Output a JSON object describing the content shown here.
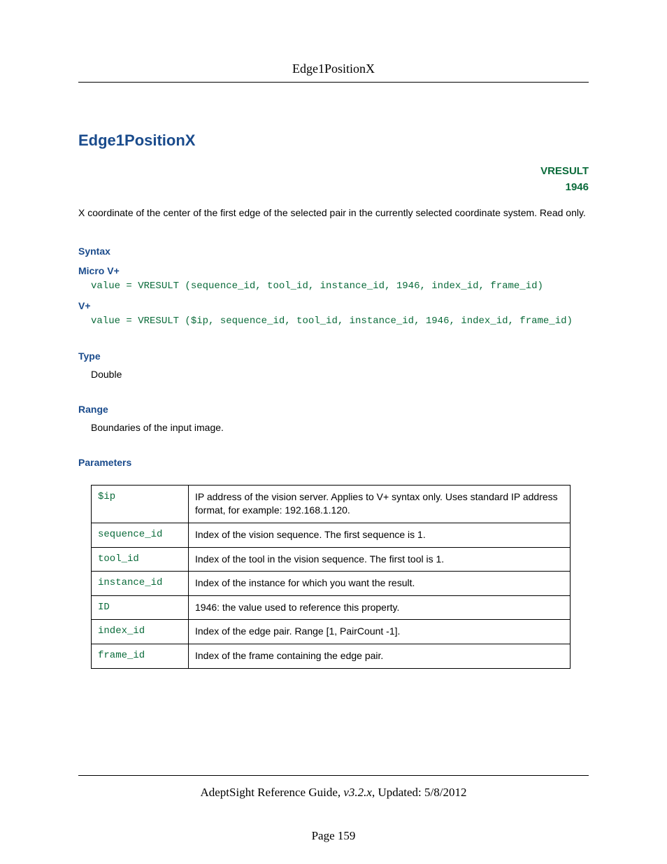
{
  "header": {
    "title": "Edge1PositionX"
  },
  "main": {
    "title": "Edge1PositionX",
    "badge": {
      "line1": "VRESULT",
      "line2": "1946"
    },
    "description": "X coordinate of the center of the first edge of the selected pair in the currently selected coordinate system. Read only."
  },
  "syntax": {
    "heading": "Syntax",
    "micro": {
      "label": "Micro V+",
      "code": "value = VRESULT (sequence_id, tool_id, instance_id, 1946, index_id, frame_id)"
    },
    "vplus": {
      "label": "V+",
      "code": "value = VRESULT ($ip, sequence_id, tool_id, instance_id, 1946, index_id, frame_id)"
    }
  },
  "type": {
    "heading": "Type",
    "value": "Double"
  },
  "range": {
    "heading": "Range",
    "value": "Boundaries of the input image."
  },
  "parameters": {
    "heading": "Parameters",
    "rows": [
      {
        "name": "$ip",
        "desc": "IP address of the vision server. Applies to V+ syntax only. Uses standard IP address format, for example: 192.168.1.120."
      },
      {
        "name": "sequence_id",
        "desc": "Index of the vision sequence. The first sequence is 1."
      },
      {
        "name": "tool_id",
        "desc": "Index of the tool in the vision sequence. The first tool is 1."
      },
      {
        "name": "instance_id",
        "desc": "Index of the instance for which you want the result."
      },
      {
        "name": "ID",
        "desc": "1946: the value used to reference this property."
      },
      {
        "name": "index_id",
        "desc": "Index of the edge pair. Range [1, PairCount -1]."
      },
      {
        "name": "frame_id",
        "desc": "Index of the frame containing the edge pair."
      }
    ]
  },
  "footer": {
    "doc_title": "AdeptSight Reference Guide",
    "version": ", v3.2.x",
    "updated_label": ", Updated: ",
    "updated_date": "5/8/2012",
    "page_label": "Page ",
    "page_number": "159"
  }
}
